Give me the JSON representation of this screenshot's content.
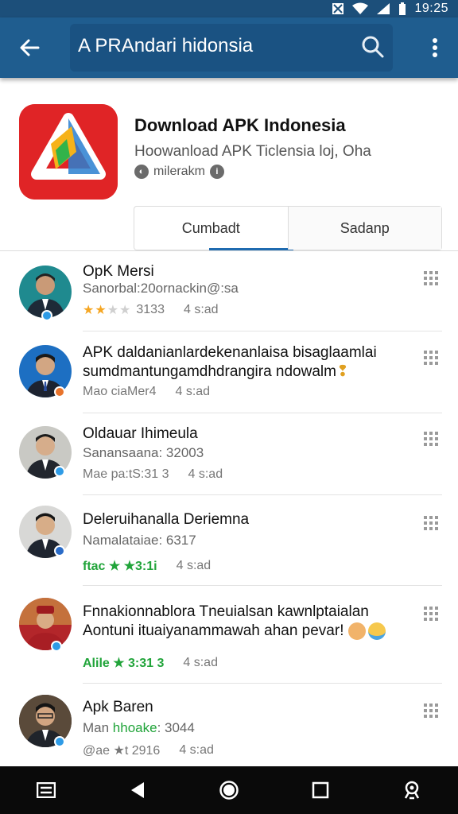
{
  "status_bar": {
    "time": "19:25"
  },
  "app_bar": {
    "search_text": "A PRAndari hidonsia",
    "back_icon": "arrow-left-icon",
    "search_icon": "search-icon",
    "menu_icon": "more-vert-icon"
  },
  "app": {
    "title": "Download APK Indonesia",
    "subtitle": "Hoowanload APK Ticlensia loj, Oha",
    "developer": "milerakm",
    "icon_color": "#e02426"
  },
  "tabs": [
    {
      "label": "Cumbadt",
      "active": true
    },
    {
      "label": "Sadanp",
      "active": false
    }
  ],
  "reviews": [
    {
      "title": "OpK Mersi",
      "title_line2": "",
      "subtitle": "Sanorbal:20ornackin@:sa",
      "rating": "3133",
      "stars": "★★★★★",
      "time": "4 s:ad",
      "rating_green": false,
      "avatar_bg": "#1f8a8f",
      "badge_color": "#2e9be6"
    },
    {
      "title": "APK daldanianlardekenanlaisa bisaglaamlai",
      "title_line2": "sumdmantungamdhdrangira ndowalm",
      "subtitle": "",
      "rating": "Mao ciaMer4",
      "stars": "",
      "time": "4 s:ad",
      "rating_green": false,
      "avatar_bg": "#1d6fc2",
      "badge_color": "#e8732b"
    },
    {
      "title": "Oldauar Ihimeula",
      "title_line2": "",
      "subtitle": "Sanansaana: 32003",
      "rating": "Mae pa:tS:31 3",
      "stars": "",
      "time": "4 s:ad",
      "rating_green": false,
      "avatar_bg": "#c9c9c4",
      "badge_color": "#2e9be6"
    },
    {
      "title": "Deleruihanalla Deriemna",
      "title_line2": "",
      "subtitle": "Namalataiae: 6317",
      "rating": "ftac ★ ★3:1i",
      "stars": "",
      "time": "4 s:ad",
      "rating_green": true,
      "avatar_bg": "#d8d8d6",
      "badge_color": "#2a6bc7"
    },
    {
      "title": "Fnnakionnablora Tneuialsan kawnlptaialan",
      "title_line2": "Aontuni ituaiyanammawah ahan pevar!",
      "subtitle": "",
      "rating": "Alile ★ 3:31 3",
      "stars": "",
      "time": "4 s:ad",
      "rating_green": true,
      "avatar_bg": "#b3262a",
      "badge_color": "#2e9be6"
    },
    {
      "title": "Apk Baren",
      "title_line2": "",
      "subtitle": "Man hhoake: 3044",
      "subtitle_green_word": "hhoake",
      "rating": "@ae ★t 2916",
      "stars": "",
      "time": "4 s:ad",
      "rating_green": false,
      "avatar_bg": "#3a3a3a",
      "badge_color": "#2e9be6"
    }
  ],
  "nav_bar": {
    "icons": [
      "recents-list-icon",
      "back-triangle-icon",
      "home-circle-icon",
      "overview-square-icon",
      "assistant-icon"
    ]
  }
}
